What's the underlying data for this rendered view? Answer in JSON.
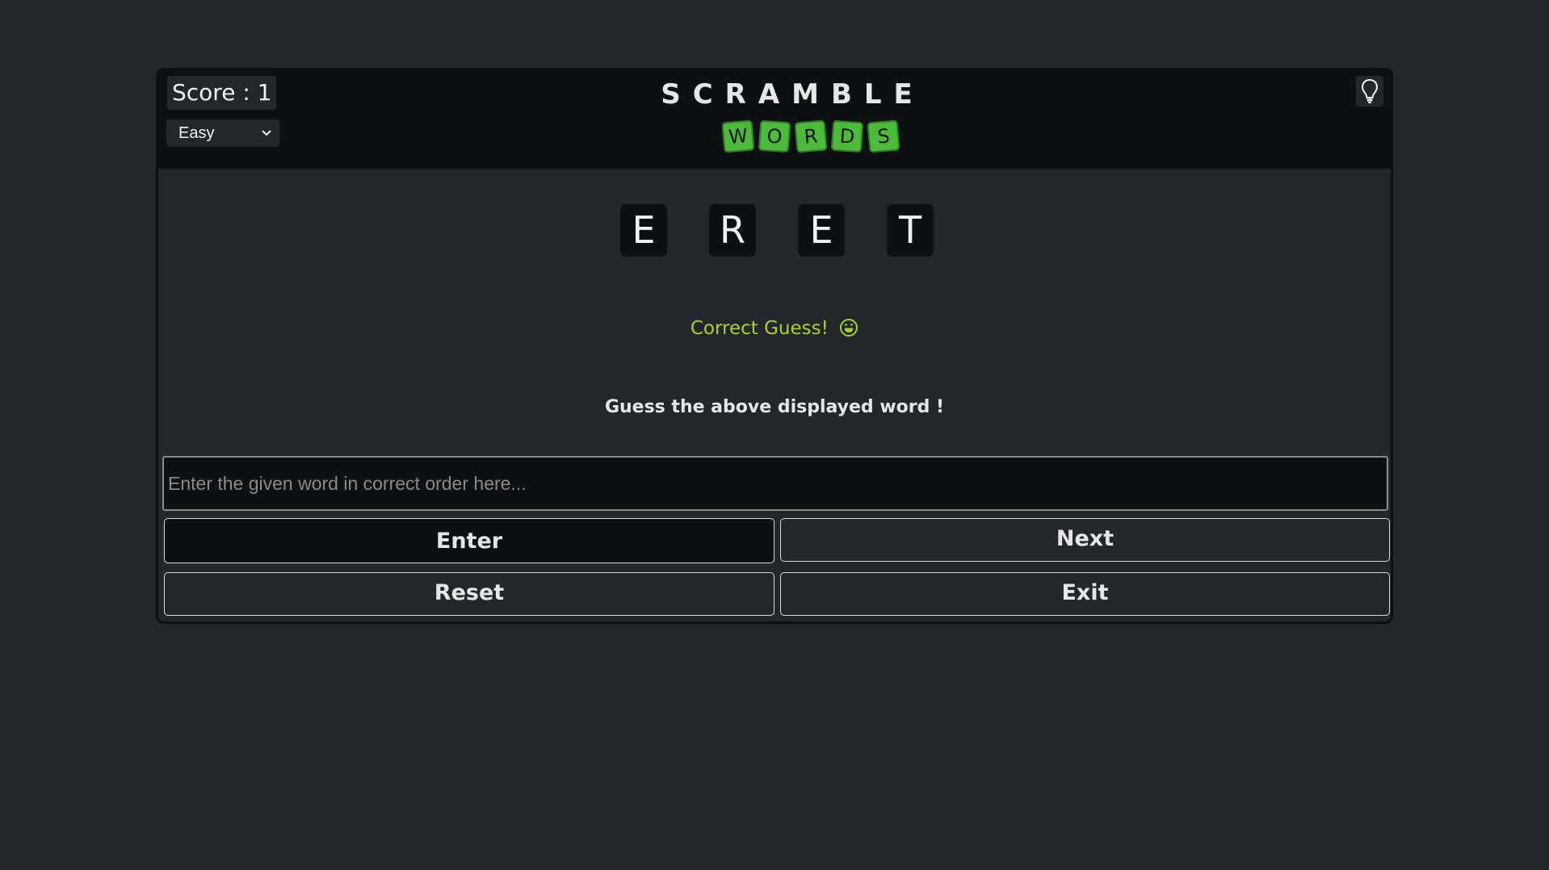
{
  "header": {
    "score_text": "Score : 1",
    "difficulty": "Easy",
    "title": "SCRAMBLE",
    "logo_tiles": [
      "W",
      "O",
      "R",
      "D",
      "S"
    ],
    "hint_icon": "lightbulb-icon"
  },
  "game": {
    "scrambled_letters": [
      "E",
      "R",
      "E",
      "T"
    ],
    "status_message": "Correct Guess!",
    "status_emoji": "😄",
    "instruction": "Guess the above displayed word !",
    "input_value": "",
    "input_placeholder": "Enter the given word in correct order here..."
  },
  "buttons": {
    "enter": "Enter",
    "next": "Next",
    "reset": "Reset",
    "exit": "Exit"
  },
  "colors": {
    "background": "#23272b",
    "header": "#0d1012",
    "logo_tile": "#4cbb3a",
    "success": "#a3d624"
  }
}
